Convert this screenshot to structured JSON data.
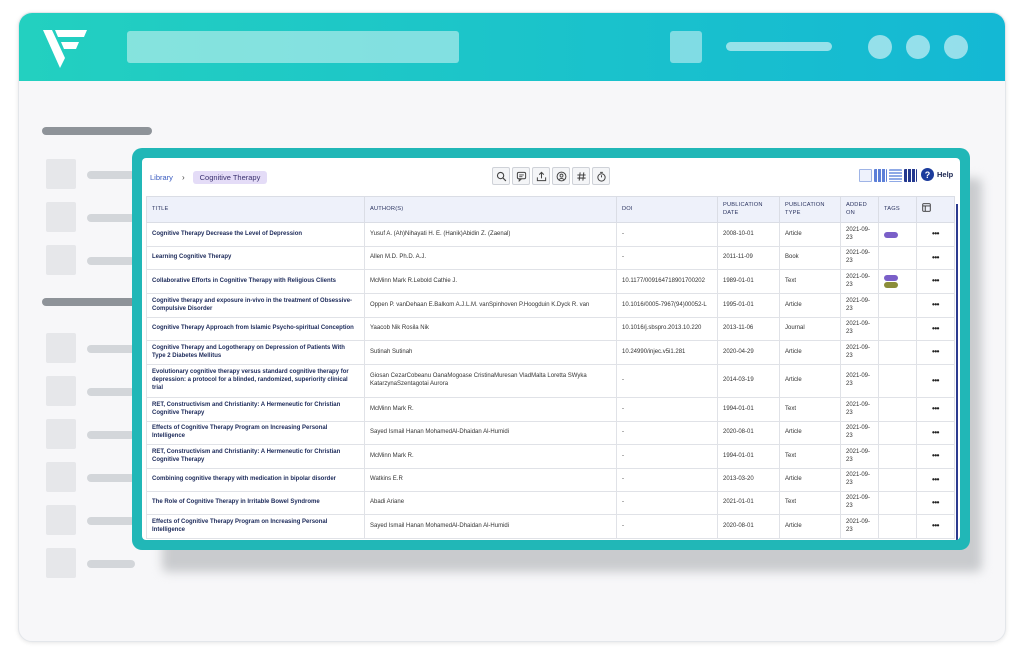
{
  "colors": {
    "teal": "#21b7b7",
    "topbar": "#14b8d4",
    "accent": "#3a5bbf",
    "tag_purple": "#7a5fc8",
    "tag_olive": "#8b8d3a"
  },
  "breadcrumb": {
    "library": "Library",
    "separator": "›",
    "current": "Cognitive Therapy"
  },
  "toolbar": {
    "icons": [
      "search-icon",
      "chat-icon",
      "export-icon",
      "user-icon",
      "hash-icon",
      "timer-icon"
    ]
  },
  "views": {
    "icons": [
      "image-view-icon",
      "grid-view-icon",
      "list-view-icon",
      "table-view-icon"
    ]
  },
  "help": {
    "label": "Help"
  },
  "table": {
    "headers": {
      "title": "TITLE",
      "authors": "AUTHOR(S)",
      "doi": "DOI",
      "pub_date": "PUBLICATION DATE",
      "pub_type": "PUBLICATION TYPE",
      "added": "ADDED ON",
      "tags": "TAGS"
    },
    "rows": [
      {
        "title": "Cognitive Therapy Decrease the Level of Depression",
        "authors": "Yusuf A. (Ah)Nihayati H. E. (Hanik)Abidin Z. (Zaenal)",
        "doi": "-",
        "date": "2008-10-01",
        "type": "Article",
        "added": "2021-09-23",
        "tags": [
          "purple"
        ]
      },
      {
        "title": "Learning Cognitive Therapy",
        "authors": "Allen M.D. Ph.D. A.J.",
        "doi": "-",
        "date": "2011-11-09",
        "type": "Book",
        "added": "2021-09-23",
        "tags": []
      },
      {
        "title": "Collaborative Efforts in Cognitive Therapy with Religious Clients",
        "authors": "McMinn Mark R.Lebold Cathie J.",
        "doi": "10.1177/009164718901700202",
        "date": "1989-01-01",
        "type": "Text",
        "added": "2021-09-23",
        "tags": [
          "purple",
          "olive"
        ]
      },
      {
        "title": "Cognitive therapy and exposure in-vivo in the treatment of Obsessive-Compulsive Disorder",
        "authors": "Oppen P. vanDehaan E.Balkom A.J.L.M. vanSpinhoven P.Hoogduin K.Dyck R. van",
        "doi": "10.1016/0005-7967(94)00052-L",
        "date": "1995-01-01",
        "type": "Article",
        "added": "2021-09-23",
        "tags": []
      },
      {
        "title": "Cognitive Therapy Approach from Islamic Psycho-spiritual Conception",
        "authors": "Yaacob Nik Rosila Nik",
        "doi": "10.1016/j.sbspro.2013.10.220",
        "date": "2013-11-06",
        "type": "Journal",
        "added": "2021-09-23",
        "tags": []
      },
      {
        "title": "Cognitive Therapy and Logotherapy on Depression of Patients With Type 2 Diabetes Mellitus",
        "authors": "Sutinah Sutinah",
        "doi": "10.24990/injec.v5i1.281",
        "date": "2020-04-29",
        "type": "Article",
        "added": "2021-09-23",
        "tags": []
      },
      {
        "title": "Evolutionary cognitive therapy versus standard cognitive therapy for depression: a protocol for a blinded, randomized, superiority clinical trial",
        "authors": "Giosan CezarCobeanu OanaMogoase CristinaMuresan VladMalta Loretta SWyka KatarzynaSzentagotai Aurora",
        "doi": "-",
        "date": "2014-03-19",
        "type": "Article",
        "added": "2021-09-23",
        "tags": []
      },
      {
        "title": "RET, Constructivism and Christianity: A Hermeneutic for Christian Cognitive Therapy",
        "authors": "McMinn Mark R.",
        "doi": "-",
        "date": "1994-01-01",
        "type": "Text",
        "added": "2021-09-23",
        "tags": []
      },
      {
        "title": "Effects of Cognitive Therapy Program on Increasing Personal Intelligence",
        "authors": "Sayed Ismail Hanan MohamedAl-Dhaidan Al-Humidi",
        "doi": "-",
        "date": "2020-08-01",
        "type": "Article",
        "added": "2021-09-23",
        "tags": []
      },
      {
        "title": "RET, Constructivism and Christianity: A Hermeneutic for Christian Cognitive Therapy",
        "authors": "McMinn Mark R.",
        "doi": "-",
        "date": "1994-01-01",
        "type": "Text",
        "added": "2021-09-23",
        "tags": []
      },
      {
        "title": "Combining cognitive therapy with medication in bipolar disorder",
        "authors": "Watkins E.R",
        "doi": "-",
        "date": "2013-03-20",
        "type": "Article",
        "added": "2021-09-23",
        "tags": []
      },
      {
        "title": "The Role of Cognitive Therapy in Irritable Bowel Syndrome",
        "authors": "Abadi Ariane",
        "doi": "-",
        "date": "2021-01-01",
        "type": "Text",
        "added": "2021-09-23",
        "tags": []
      },
      {
        "title": "Effects of Cognitive Therapy Program on Increasing Personal Intelligence",
        "authors": "Sayed Ismail Hanan MohamedAl-Dhaidan Al-Humidi",
        "doi": "-",
        "date": "2020-08-01",
        "type": "Article",
        "added": "2021-09-23",
        "tags": []
      }
    ]
  }
}
